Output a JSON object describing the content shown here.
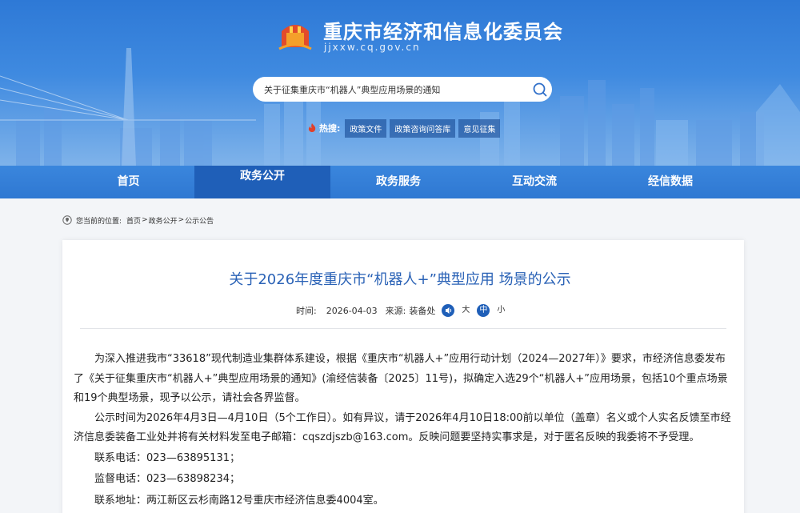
{
  "header": {
    "site_title": "重庆市经济和信息化委员会",
    "site_url": "jjxxw.cq.gov.cn"
  },
  "search": {
    "value": "关于征集重庆市“机器人”典型应用场景的通知",
    "icon": "search-icon"
  },
  "hot_search": {
    "label": "热搜:",
    "tags": [
      "政策文件",
      "政策咨询问答库",
      "意见征集"
    ]
  },
  "nav": {
    "items": [
      "首页",
      "政务公开",
      "政务服务",
      "互动交流",
      "经信数据"
    ],
    "active_index": 1
  },
  "breadcrumb": {
    "prefix": "您当前的位置:",
    "items": [
      "首页",
      "政务公开",
      "公示公告"
    ],
    "separator": ">"
  },
  "article": {
    "title": "关于2026年度重庆市“机器人+”典型应用 场景的公示",
    "time_label": "时间:",
    "date": "2026-04-03",
    "source_label": "来源:",
    "source": "装备处",
    "font_sizes": [
      "大",
      "中",
      "小"
    ],
    "font_size_selected": "中",
    "paragraphs": [
      "为深入推进我市“33618”现代制造业集群体系建设，根据《重庆市“机器人+”应用行动计划（2024—2027年）》要求，市经济信息委发布了《关于征集重庆市“机器人+”典型应用场景的通知》(渝经信装备〔2025〕11号)，拟确定入选29个“机器人+”应用场景，包括10个重点场景和19个典型场景，现予以公示，请社会各界监督。",
      "公示时间为2026年4月3日—4月10日（5个工作日）。如有异议，请于2026年4月10日18:00前以单位（盖章）名义或个人实名反馈至市经济信息委装备工业处并将有关材料发至电子邮箱：cqszdjszb@163.com。反映问题要坚持实事求是，对于匿名反映的我委将不予受理。"
    ],
    "contacts": [
      "联系电话：023—63895131；",
      "监督电话：023—63898234；",
      "联系地址：两江新区云杉南路12号重庆市经济信息委4004室。"
    ]
  },
  "colors": {
    "brand_blue": "#2f78d2",
    "nav_active": "#1f5fb8",
    "title_blue": "#2a62b6",
    "hot_red": "#e0402a"
  }
}
